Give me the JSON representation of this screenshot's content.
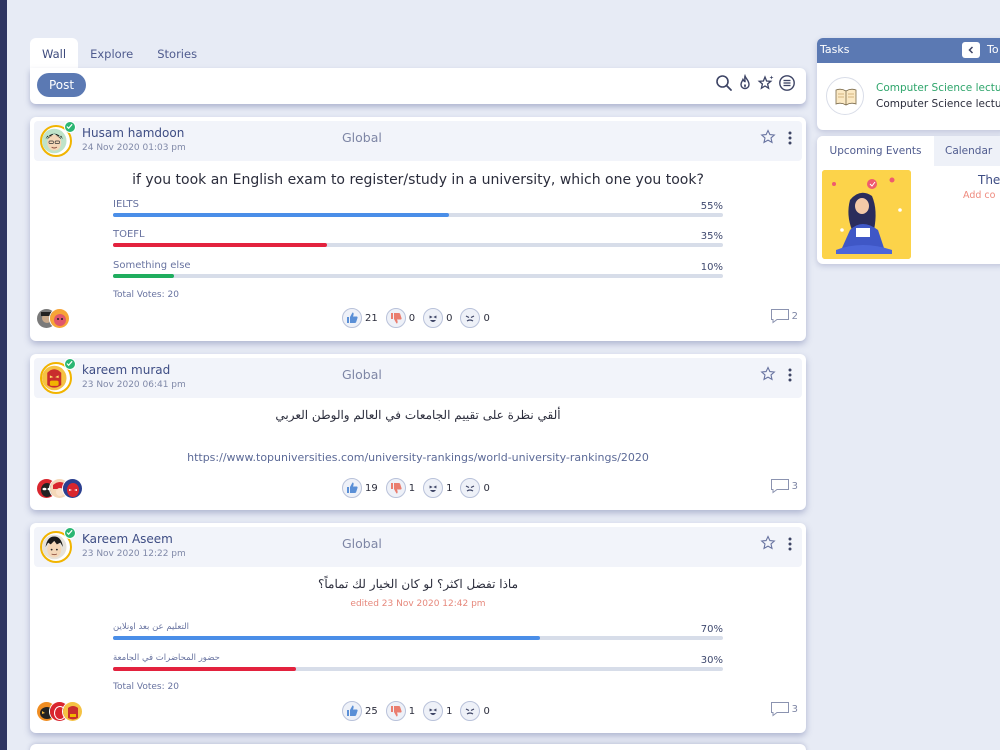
{
  "tabs": [
    "Wall",
    "Explore",
    "Stories"
  ],
  "post_button": "Post",
  "toolbar_icons": [
    "search-icon",
    "fire-icon",
    "star-sparkle-icon",
    "list-icon"
  ],
  "posts": [
    {
      "author": "Husam hamdoon",
      "date": "24 Nov 2020 01:03 pm",
      "scope": "Global",
      "question": "if you took an English exam to register/study in a university, which one you took?",
      "options": [
        {
          "label": "IELTS",
          "percent": 55,
          "percent_label": "55%",
          "color": "#4a8ee8"
        },
        {
          "label": "TOEFL",
          "percent": 35,
          "percent_label": "35%",
          "color": "#e3223e"
        },
        {
          "label": "Something else",
          "percent": 10,
          "percent_label": "10%",
          "color": "#1fad5e"
        }
      ],
      "total_votes": "Total Votes: 20",
      "reactions": {
        "like": "21",
        "dislike": "0",
        "laugh": "0",
        "angry": "0"
      },
      "comments": "2"
    },
    {
      "author": "kareem murad",
      "date": "23 Nov 2020 06:41 pm",
      "scope": "Global",
      "text": "ألقي نظرة على تقييم الجامعات في العالم والوطن العربي",
      "link": "https://www.topuniversities.com/university-rankings/world-university-rankings/2020",
      "reactions": {
        "like": "19",
        "dislike": "1",
        "laugh": "1",
        "angry": "0"
      },
      "comments": "3"
    },
    {
      "author": "Kareem Aseem",
      "date": "23 Nov 2020 12:22 pm",
      "scope": "Global",
      "question": "ماذا تفضل اكثر؟ لو كان الخيار لك تماماً؟",
      "edited": "edited 23 Nov 2020 12:42 pm",
      "options": [
        {
          "label": "التعليم عن بعد اونلاين",
          "percent": 70,
          "percent_label": "70%",
          "color": "#4a8ee8"
        },
        {
          "label": "حضور المحاضرات في الجامعة",
          "percent": 30,
          "percent_label": "30%",
          "color": "#e3223e"
        }
      ],
      "total_votes": "Total Votes: 20",
      "reactions": {
        "like": "25",
        "dislike": "1",
        "laugh": "1",
        "angry": "0"
      },
      "comments": "3"
    }
  ],
  "tasks": {
    "title": "Tasks",
    "tab_partial": "To",
    "course_title": "Computer Science lecture",
    "course_sub": "Computer Science lecture"
  },
  "events": {
    "tabs": [
      "Upcoming Events",
      "Calendar"
    ],
    "title_partial": "The",
    "add_partial": "Add co"
  },
  "colors": {
    "accent": "#5b79b3",
    "sidebar": "#2e3561",
    "verified": "#2bb673"
  }
}
